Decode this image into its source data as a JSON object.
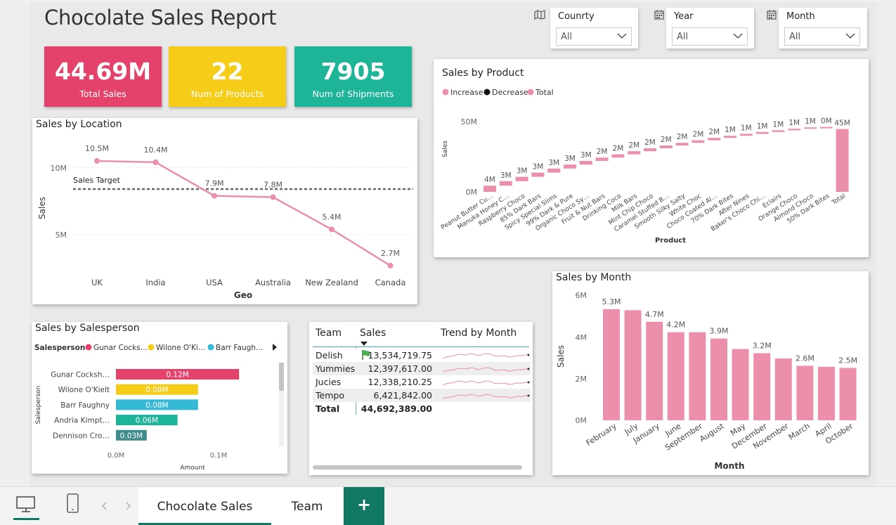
{
  "report_title": "Chocolate Sales Report",
  "kpis": [
    {
      "value": "44.69M",
      "label": "Total Sales",
      "color": "#e5426b"
    },
    {
      "value": "22",
      "label": "Num of Products",
      "color": "#f5cd19"
    },
    {
      "value": "7905",
      "label": "Num of Shipments",
      "color": "#1db497"
    }
  ],
  "slicers": [
    {
      "label": "Counrty",
      "value": "All",
      "icon": "map-icon"
    },
    {
      "label": "Year",
      "value": "All",
      "icon": "calendar-icon"
    },
    {
      "label": "Month",
      "value": "All",
      "icon": "calendar-icon"
    }
  ],
  "location": {
    "title": "Sales by Location",
    "xlabel": "Geo",
    "ylabel": "Sales",
    "target_label": "Sales Target",
    "ticks": [
      "10M",
      "5M"
    ]
  },
  "product": {
    "title": "Sales by Product",
    "legend": [
      "Increase",
      "Decrease",
      "Total"
    ],
    "xlabel": "Product",
    "ylabel": "Sales",
    "ticks": [
      "50M",
      "0M"
    ]
  },
  "month": {
    "title": "Sales by Month",
    "xlabel": "Month",
    "ylabel": "Sales",
    "ticks": [
      "6M",
      "4M",
      "2M",
      "0M"
    ]
  },
  "salesperson": {
    "title": "Sales by Salesperson",
    "legend_title": "Salesperson",
    "legend": [
      "Gunar Cocks…",
      "Wilone O'Ki…",
      "Barr Faugh…"
    ],
    "xlabel": "Amount",
    "ylabel": "Salesperson",
    "ticks": [
      "0.0M",
      "0.1M"
    ]
  },
  "team_table": {
    "headers": [
      "Team",
      "Sales",
      "Trend by Month"
    ],
    "rows": [
      {
        "team": "Delish",
        "sales": "13,534,719.75"
      },
      {
        "team": "Yummies",
        "sales": "12,397,617.00"
      },
      {
        "team": "Jucies",
        "sales": "12,338,210.25"
      },
      {
        "team": "Tempo",
        "sales": "6,421,842.00"
      }
    ],
    "total": {
      "team": "Total",
      "sales": "44,692,389.00"
    }
  },
  "tabs": {
    "active": "Chocolate Sales",
    "other": "Team",
    "add": "+"
  },
  "colors": {
    "pink": "#ec8fab",
    "accent": "#117865",
    "magenta": "#e5426b",
    "yellow": "#f5cd19",
    "teal": "#1db497",
    "cyan": "#34b9d6",
    "darkteal": "#3f8c8c"
  },
  "chart_data": [
    {
      "type": "line",
      "title": "Sales by Location",
      "categories": [
        "UK",
        "India",
        "USA",
        "Australia",
        "New Zealand",
        "Canada"
      ],
      "values": [
        10.5,
        10.4,
        7.9,
        7.8,
        5.4,
        2.7
      ],
      "labels": [
        "10.5M",
        "10.4M",
        "7.9M",
        "7.8M",
        "5.4M",
        "2.7M"
      ],
      "target": 8.4,
      "ylim": [
        2,
        11.5
      ],
      "xlabel": "Geo",
      "ylabel": "Sales"
    },
    {
      "type": "bar",
      "subtype": "waterfall",
      "title": "Sales by Product",
      "categories": [
        "Peanut Butter Cu…",
        "Manuka Honey C…",
        "Raspberry Choco",
        "85% Dark Bars",
        "Spicy Special Slims",
        "99% Dark & Pure",
        "Organic Choco Sy…",
        "Fruit & Nut Bars",
        "Drinking Coco",
        "Milk Bars",
        "Mint Chip Choco",
        "Caramel Stuffed B…",
        "Smooth Silky Salty",
        "White Choc",
        "Choco Coated Al…",
        "70% Dark Bites",
        "After Nines",
        "Baker's Choco Chi…",
        "Eclairs",
        "Orange Choco",
        "Almond Choco",
        "50% Dark Bites",
        "Total"
      ],
      "labels": [
        "4M",
        "3M",
        "3M",
        "3M",
        "3M",
        "3M",
        "3M",
        "2M",
        "2M",
        "2M",
        "2M",
        "2M",
        "2M",
        "2M",
        "2M",
        "1M",
        "1M",
        "1M",
        "1M",
        "1M",
        "1M",
        "0M",
        "45M"
      ],
      "values": [
        4.4,
        3.2,
        3.1,
        3.0,
        2.9,
        2.8,
        2.6,
        2.4,
        2.3,
        2.2,
        2.1,
        2.0,
        1.9,
        1.8,
        1.7,
        1.5,
        1.4,
        1.3,
        1.2,
        1.1,
        1.0,
        0.3,
        44.69
      ],
      "ylim": [
        0,
        50
      ],
      "xlabel": "Product",
      "ylabel": "Sales"
    },
    {
      "type": "bar",
      "title": "Sales by Month",
      "categories": [
        "February",
        "July",
        "January",
        "June",
        "September",
        "August",
        "May",
        "December",
        "November",
        "March",
        "April",
        "October"
      ],
      "values": [
        5.3,
        5.25,
        4.7,
        4.2,
        4.2,
        3.9,
        3.4,
        3.2,
        2.95,
        2.6,
        2.55,
        2.5
      ],
      "labels": [
        "5.3M",
        "",
        "4.7M",
        "4.2M",
        "",
        "3.9M",
        "",
        "3.2M",
        "",
        "2.6M",
        "",
        "2.5M"
      ],
      "ylim": [
        0,
        6
      ],
      "xlabel": "Month",
      "ylabel": "Sales"
    },
    {
      "type": "bar",
      "orientation": "horizontal",
      "title": "Sales by Salesperson",
      "categories": [
        "Gunar Cocksh…",
        "Wilone O'Kielt",
        "Barr Faughny",
        "Andria Kimpt…",
        "Dennison Cro…"
      ],
      "values": [
        0.12,
        0.08,
        0.08,
        0.06,
        0.03
      ],
      "labels": [
        "0.12M",
        "0.08M",
        "0.08M",
        "0.06M",
        "0.03M"
      ],
      "xlim": [
        0,
        0.1
      ],
      "xlabel": "Amount",
      "ylabel": "Salesperson"
    }
  ]
}
